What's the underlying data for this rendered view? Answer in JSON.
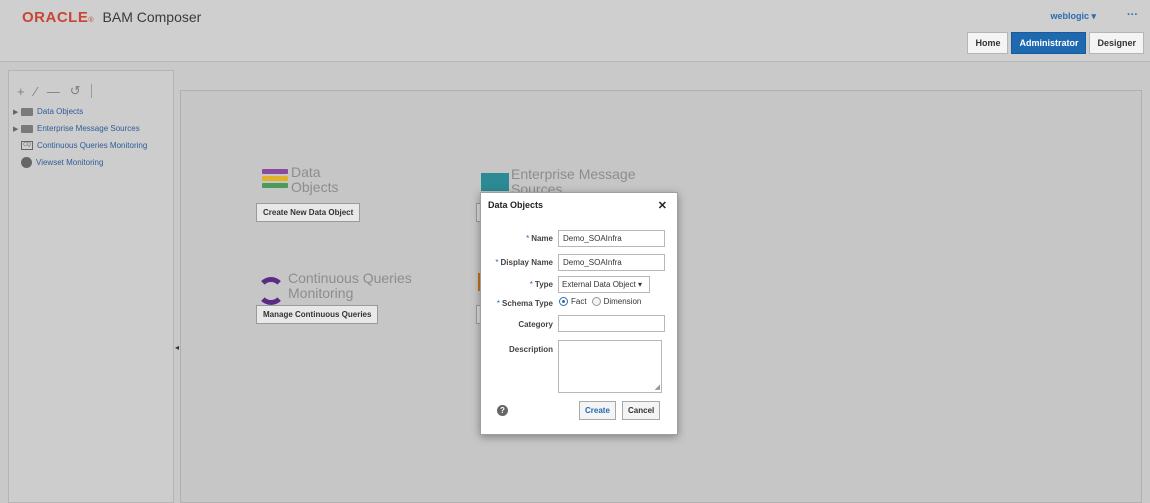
{
  "header": {
    "brand": "ORACLE",
    "brand_mark": "®",
    "product": "BAM Composer",
    "user": "weblogic ▾",
    "more": "···",
    "tabs": [
      {
        "label": "Home",
        "active": false
      },
      {
        "label": "Administrator",
        "active": true
      },
      {
        "label": "Designer",
        "active": false
      }
    ]
  },
  "left_panel": {
    "toolbar": {
      "add": "+",
      "edit": "∕",
      "remove": "—",
      "refresh": "↺"
    },
    "tree": [
      {
        "label": "Data Objects",
        "icon": "folder-icon",
        "expandable": true
      },
      {
        "label": "Enterprise Message Sources",
        "icon": "folder-icon",
        "expandable": true
      },
      {
        "label": "Continuous Queries Monitoring",
        "icon": "cq-icon",
        "expandable": false
      },
      {
        "label": "Viewset Monitoring",
        "icon": "viewset-icon",
        "expandable": false
      }
    ],
    "collapse_handle": "◂"
  },
  "main": {
    "tiles": [
      {
        "title_line1": "Data",
        "title_line2": "Objects",
        "button": "Create New Data Object"
      },
      {
        "title_line1": "Enterprise Message",
        "title_line2": "Sources",
        "button": ""
      },
      {
        "title_line1": "Continuous Queries",
        "title_line2": "Monitoring",
        "button": "Manage Continuous Queries"
      }
    ],
    "colors": {
      "stripes": [
        "#8a4b9a",
        "#e0b22a",
        "#4b9a5a"
      ],
      "envelope": "#2b8a93",
      "refresh": "#5b2a86"
    }
  },
  "dialog": {
    "title": "Data Objects",
    "close": "✕",
    "required_mark": "*",
    "fields": {
      "name": {
        "label": "Name",
        "value": "Demo_SOAInfra"
      },
      "display_name": {
        "label": "Display Name",
        "value": "Demo_SOAInfra"
      },
      "type": {
        "label": "Type",
        "value": "External Data Object ▾"
      },
      "schema_type": {
        "label": "Schema Type",
        "options": [
          "Fact",
          "Dimension"
        ],
        "selected": "Fact"
      },
      "category": {
        "label": "Category",
        "value": ""
      },
      "description": {
        "label": "Description",
        "value": ""
      }
    },
    "help": "?",
    "buttons": {
      "create": "Create",
      "cancel": "Cancel"
    }
  }
}
